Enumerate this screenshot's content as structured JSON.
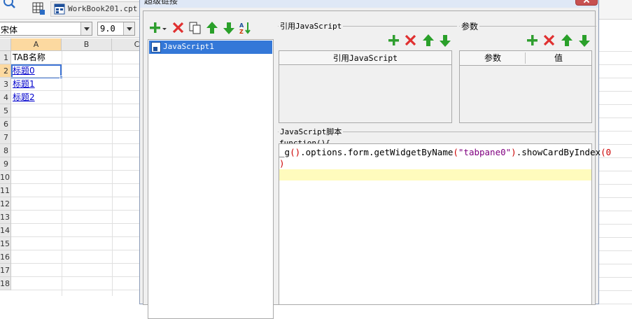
{
  "workbook_tab": {
    "label": "WorkBook201.cpt *"
  },
  "font_bar": {
    "font_name": "宋体",
    "font_size": "9.0"
  },
  "sheet": {
    "columns": [
      "A",
      "B",
      "C"
    ],
    "rows": [
      "1",
      "2",
      "3",
      "4",
      "5",
      "6",
      "7",
      "8",
      "9",
      "10",
      "11",
      "12",
      "13",
      "14",
      "15",
      "16",
      "17",
      "18"
    ],
    "cells": [
      {
        "text": "TAB名称",
        "link": false
      },
      {
        "text": "标题0",
        "link": true
      },
      {
        "text": "标题1",
        "link": true
      },
      {
        "text": "标题2",
        "link": true
      }
    ]
  },
  "dialog": {
    "title": "超级链接",
    "js_list": {
      "items": [
        "JavaScript1"
      ]
    },
    "referenced_js": {
      "group_title": "引用JavaScript",
      "column_header": "引用JavaScript"
    },
    "params": {
      "group_title": "参数",
      "columns": [
        "参数",
        "值"
      ]
    },
    "script": {
      "group_title": "JavaScript脚本",
      "header": "function(){",
      "code_line1_prefix": "_g",
      "code_line1_p1": "()",
      "code_line1_mid": ".options.form.getWidgetByName",
      "code_line1_p2": "(",
      "code_line1_str": "\"tabpane0\"",
      "code_line1_p3": ")",
      "code_line1_call": ".showCardByIndex",
      "code_line1_p4": "(",
      "code_line1_num": "0",
      "code_line2": ")"
    }
  },
  "colors": {
    "add": "#2f9e2f",
    "delete": "#e03030",
    "move": "#2aa02a",
    "selection": "#3478d8"
  }
}
